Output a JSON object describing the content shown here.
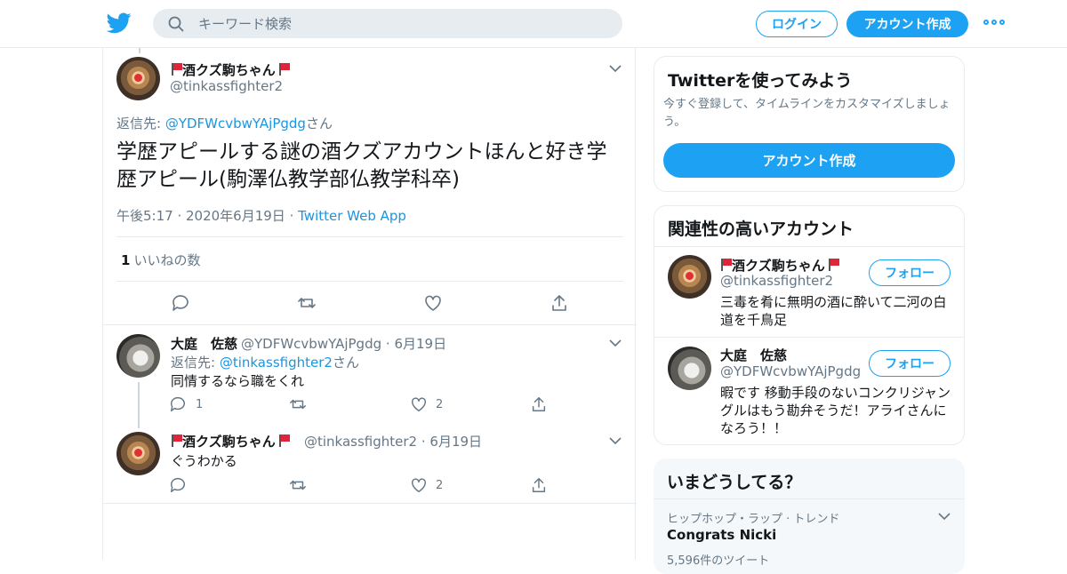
{
  "header": {
    "search_placeholder": "キーワード検索",
    "login_label": "ログイン",
    "signup_label": "アカウント作成",
    "brand_color": "#1da1f2"
  },
  "main_tweet": {
    "display_name": "酒クズ駒ちゃん",
    "handle": "@tinkassfighter2",
    "reply_prefix": "返信先: ",
    "reply_to": "@YDFWcvbwYAjPgdg",
    "reply_suffix": "さん",
    "text": "学歴アピールする謎の酒クズアカウントほんと好き学歴アピール(駒澤仏教学部仏教学科卒)",
    "time": "午後5:17",
    "date": "2020年6月19日",
    "source": "Twitter Web App",
    "likes_count": "1",
    "likes_label": "いいねの数"
  },
  "replies": [
    {
      "display_name": "大庭　佐慈",
      "handle": "@YDFWcvbwYAjPgdg",
      "date": "6月19日",
      "reply_prefix": "返信先: ",
      "reply_to": "@tinkassfighter2",
      "reply_suffix": "さん",
      "text": "同情するなら職をくれ",
      "reply_count": "1",
      "like_count": "2"
    },
    {
      "display_name": "酒クズ駒ちゃん",
      "handle": "@tinkassfighter2",
      "date": "6月19日",
      "text": "ぐうわかる",
      "like_count": "2"
    }
  ],
  "sidebar": {
    "promo": {
      "title": "Twitterを使ってみよう",
      "subtitle": "今すぐ登録して、タイムラインをカスタマイズしましょう。",
      "button": "アカウント作成"
    },
    "related": {
      "title": "関連性の高いアカウント",
      "follow_label": "フォロー",
      "accounts": [
        {
          "display_name": "酒クズ駒ちゃん",
          "handle": "@tinkassfighter2",
          "bio": "三毒を肴に無明の酒に酔いて二河の白道を千鳥足"
        },
        {
          "display_name": "大庭　佐慈",
          "handle": "@YDFWcvbwYAjPgdg",
          "bio": "暇です 移動手段のないコンクリジャングルはもう勘弁そうだ！アライさんになろう！！"
        }
      ]
    },
    "trends": {
      "title": "いまどうしてる？",
      "items": [
        {
          "category": "ヒップホップ・ラップ · トレンド",
          "name": "Congrats Nicki",
          "count": "5,596件のツイート"
        }
      ]
    }
  }
}
